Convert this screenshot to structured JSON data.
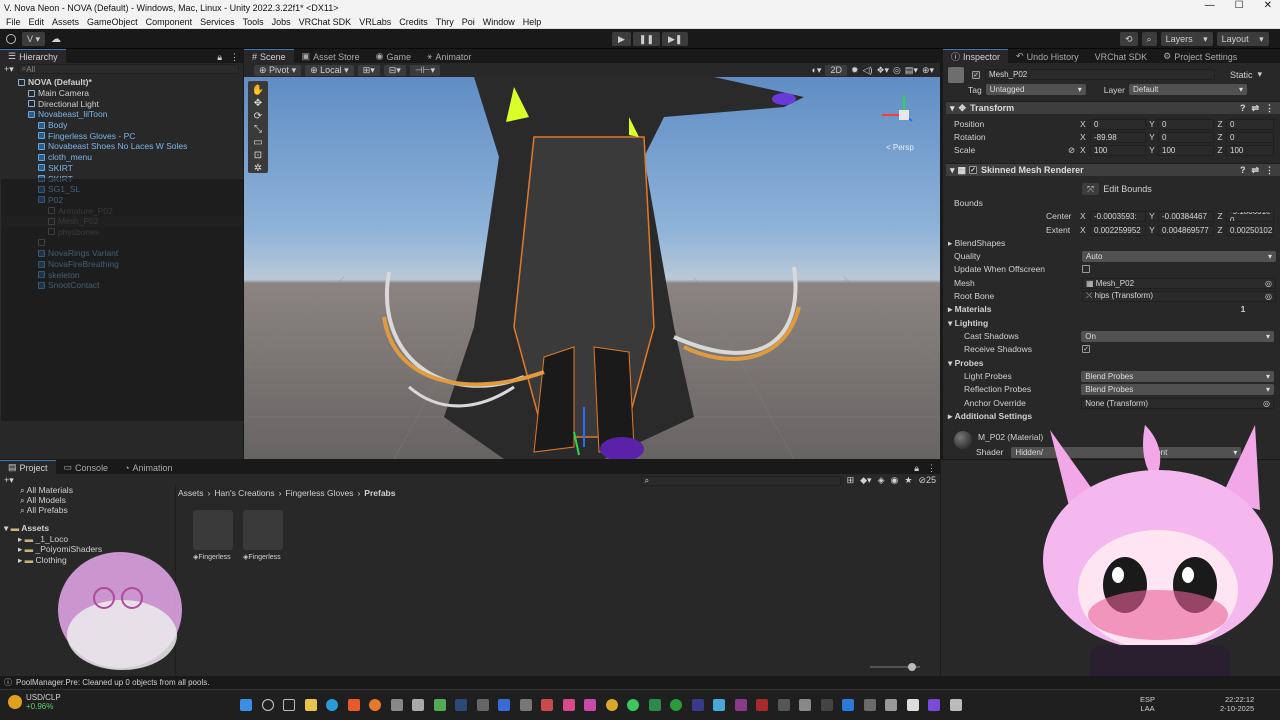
{
  "window": {
    "title": "V. Nova Neon - NOVA (Default) - Windows, Mac, Linux - Unity 2022.3.22f1* <DX11>",
    "minimize": "—",
    "maximize": "☐",
    "close": "✕"
  },
  "menu": [
    "File",
    "Edit",
    "Assets",
    "GameObject",
    "Component",
    "Services",
    "Tools",
    "Jobs",
    "VRChat SDK",
    "VRLabs",
    "Credits",
    "Thry",
    "Poi",
    "Window",
    "Help"
  ],
  "toolbar": {
    "account": "V",
    "layers": "Layers",
    "layout": "Layout"
  },
  "hierarchy": {
    "tab": "Hierarchy",
    "search_placeholder": "All",
    "items": [
      {
        "label": "NOVA (Default)*",
        "indent": 0
      },
      {
        "label": "Main Camera",
        "indent": 1
      },
      {
        "label": "Directional Light",
        "indent": 1
      },
      {
        "label": "Novabeast_lilToon",
        "indent": 1
      },
      {
        "label": "Body",
        "indent": 2
      },
      {
        "label": "Fingerless Gloves - PC",
        "indent": 2
      },
      {
        "label": "Novabeast Shoes No Laces W Soles",
        "indent": 2
      },
      {
        "label": "cloth_menu",
        "indent": 2
      },
      {
        "label": "SKIRT",
        "indent": 2
      },
      {
        "label": "SKIRT",
        "indent": 2
      },
      {
        "label": "SG1_SL",
        "indent": 2
      },
      {
        "label": "P02",
        "indent": 2
      },
      {
        "label": "Armature_P02",
        "indent": 3
      },
      {
        "label": "Mesh_P02",
        "indent": 3
      },
      {
        "label": "physbones",
        "indent": 3
      },
      {
        "label": "",
        "indent": 2
      },
      {
        "label": "NovaRings Variant",
        "indent": 2
      },
      {
        "label": "NovaFireBreathing",
        "indent": 2
      },
      {
        "label": "skeleton",
        "indent": 2
      },
      {
        "label": "SnootContact",
        "indent": 2
      }
    ]
  },
  "scene_tabs": [
    "Scene",
    "Asset Store",
    "Game",
    "Animator"
  ],
  "scene_toolbar": {
    "pivot": "Pivot",
    "local": "Local",
    "mode_2d": "2D",
    "persp": "< Persp"
  },
  "inspector": {
    "tabs": [
      "Inspector",
      "Undo History",
      "VRChat SDK",
      "Project Settings"
    ],
    "object_name": "Mesh_P02",
    "static_label": "Static",
    "tag_label": "Tag",
    "tag_value": "Untagged",
    "layer_label": "Layer",
    "layer_value": "Default",
    "transform": {
      "title": "Transform",
      "position_label": "Position",
      "rotation_label": "Rotation",
      "scale_label": "Scale",
      "position": [
        "0",
        "0",
        "0"
      ],
      "rotation": [
        "-89.98",
        "0",
        "0"
      ],
      "scale": [
        "100",
        "100",
        "100"
      ]
    },
    "smr": {
      "title": "Skinned Mesh Renderer",
      "edit_bounds": "Edit Bounds",
      "bounds_label": "Bounds",
      "center_label": "Center",
      "extent_label": "Extent",
      "center": [
        "-0.0003593:",
        "-0.00384467",
        "-5.188631e-0"
      ],
      "extent": [
        "0.002259952",
        "0.004869577",
        "0.00250102:"
      ],
      "blendshapes": "BlendShapes",
      "quality_label": "Quality",
      "quality_value": "Auto",
      "update_offscreen_label": "Update When Offscreen",
      "mesh_label": "Mesh",
      "mesh_value": "Mesh_P02",
      "root_bone_label": "Root Bone",
      "root_bone_value": "hips (Transform)",
      "materials": "Materials",
      "materials_count": "1",
      "lighting": "Lighting",
      "cast_shadows_label": "Cast Shadows",
      "cast_shadows_value": "On",
      "receive_shadows_label": "Receive Shadows",
      "probes": "Probes",
      "light_probes_label": "Light Probes",
      "light_probes_value": "Blend Probes",
      "reflection_probes_label": "Reflection Probes",
      "reflection_probes_value": "Blend Probes",
      "anchor_override_label": "Anchor Override",
      "anchor_override_value": "None (Transform)",
      "additional_settings": "Additional Settings"
    },
    "material": {
      "name": "M_P02 (Material)",
      "shader_label": "Shader",
      "shader_value": "Hidden/",
      "shader_suffix": "arent"
    }
  },
  "project": {
    "tabs": [
      "Project",
      "Console",
      "Animation"
    ],
    "favorites": [
      "All Materials",
      "All Models",
      "All Prefabs"
    ],
    "tree_root": "Assets",
    "tree_items": [
      "_1_Loco",
      "_PoiyomiShaders",
      "Clothing"
    ],
    "breadcrumb": [
      "Assets",
      "Han's Creations",
      "Fingerless Gloves",
      "Prefabs"
    ],
    "assets": [
      "Fingerless",
      "Fingerless"
    ],
    "icon_count": "25",
    "status": "PoolManager.Pre: Cleaned up 0 objects from all pools."
  },
  "taskbar": {
    "ticker_symbol": "USD/CLP",
    "ticker_change": "+0.96%",
    "lang_top": "ESP",
    "lang_bottom": "LAA",
    "time": "22:22:12",
    "date": "2-10-2025"
  }
}
